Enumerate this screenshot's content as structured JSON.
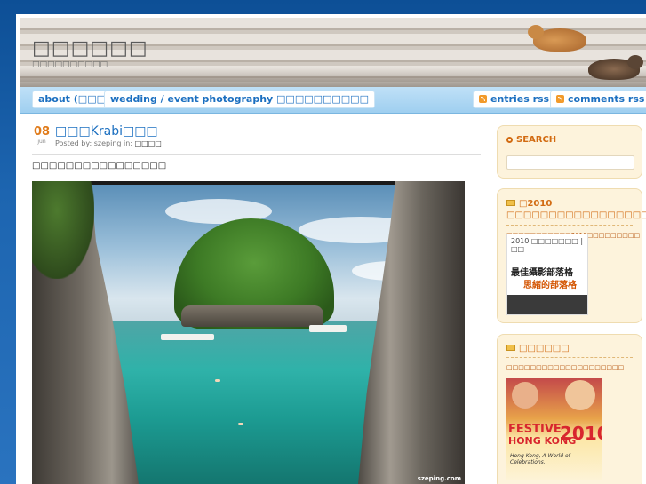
{
  "site": {
    "title": "□□□□□□",
    "subtitle": "□□□□□□□□□□"
  },
  "nav": {
    "items": [
      {
        "label": "about (□□□□□"
      },
      {
        "label": "wedding / event photography □□□□□□□□□□"
      }
    ],
    "rss": [
      {
        "label": "entries rss"
      },
      {
        "label": "comments rss"
      }
    ]
  },
  "post": {
    "day": "08",
    "month": "jun",
    "title": "□□□Krabi□□□",
    "meta_prefix": "Posted by: szeping in:",
    "category": "□□□□",
    "intro": "□□□□□□□□□□□□□□□□",
    "watermark": "szeping.com"
  },
  "sidebar": {
    "search": {
      "heading": "SEARCH",
      "placeholder": ""
    },
    "award_box": {
      "heading": "□2010 □□□□□□□□□□□□□□□□□□□",
      "link": "□□□□□□□□□□□2010□□□□□□□□□",
      "badge_top": "2010 □□□□□□□ | □□",
      "badge_main": "最佳攝影部落格",
      "badge_sub": "思緒的部落格"
    },
    "festive_box": {
      "heading": "□□□□□□",
      "link": "□□□□□□□□□□□□□□□□□□□□",
      "banner_word1": "FESTIVE",
      "banner_word2": "HONG KONG",
      "banner_year": "2010",
      "banner_tag": "Hong Kong, A World of Celebrations."
    }
  },
  "colors": {
    "accent": "#1b6fc0",
    "orange": "#d26b12",
    "background": "#1d65b0"
  }
}
